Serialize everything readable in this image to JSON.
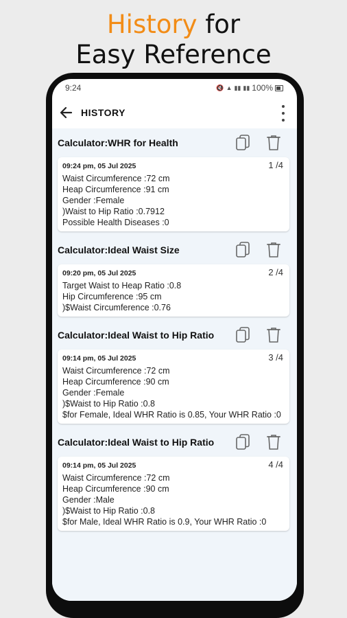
{
  "promo": {
    "line1_accent": "History",
    "line1_rest": " for",
    "line2": "Easy Reference"
  },
  "statusbar": {
    "time": "9:24",
    "battery": "100%"
  },
  "appbar": {
    "title": "HISTORY"
  },
  "entries": [
    {
      "calculator": "Calculator:WHR for Health",
      "time": "09:24 pm, 05 Jul 2025",
      "index": "1 /4",
      "lines": [
        "Waist Circumference :72 cm",
        "Heap Circumference :91 cm",
        "Gender :Female",
        ")Waist to Hip Ratio :0.7912",
        "Possible Health Diseases :0"
      ]
    },
    {
      "calculator": "Calculator:Ideal Waist Size",
      "time": "09:20 pm, 05 Jul 2025",
      "index": "2 /4",
      "lines": [
        "Target Waist to Heap Ratio :0.8",
        "Hip Circumference :95 cm",
        ")$Waist Circumference :0.76"
      ]
    },
    {
      "calculator": "Calculator:Ideal Waist to Hip Ratio",
      "time": "09:14 pm, 05 Jul 2025",
      "index": "3 /4",
      "lines": [
        "Waist Circumference :72 cm",
        "Heap Circumference :90 cm",
        "Gender :Female",
        ")$Waist to Hip Ratio :0.8",
        "$for Female, Ideal WHR Ratio is 0.85, Your WHR Ratio :0"
      ]
    },
    {
      "calculator": "Calculator:Ideal Waist to Hip Ratio",
      "time": "09:14 pm, 05 Jul 2025",
      "index": "4 /4",
      "lines": [
        "Waist Circumference :72 cm",
        "Heap Circumference :90 cm",
        "Gender :Male",
        ")$Waist to Hip Ratio :0.8",
        "$for Male, Ideal WHR Ratio is 0.9, Your WHR Ratio :0"
      ]
    }
  ]
}
